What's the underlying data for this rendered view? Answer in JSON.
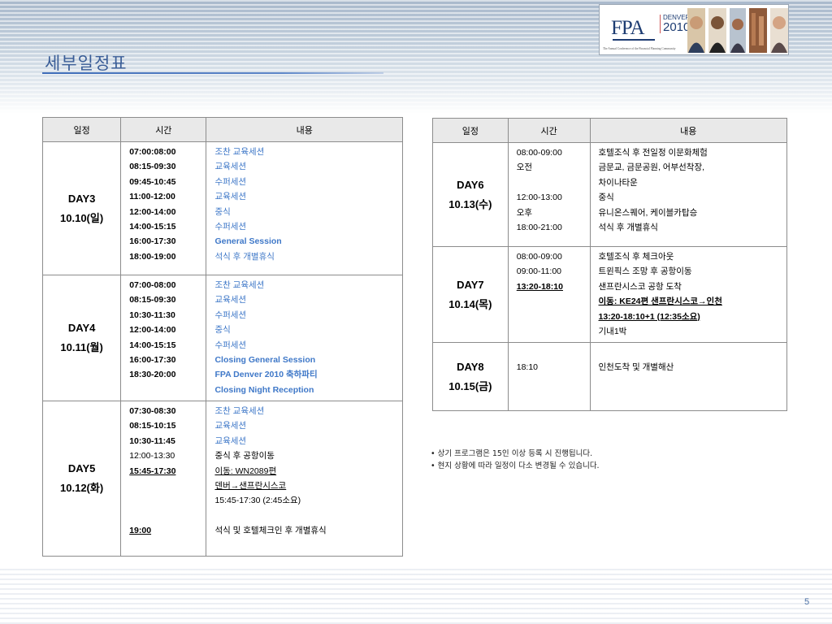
{
  "page": {
    "title": "세부일정표",
    "page_number": "5"
  },
  "logo": {
    "brand": "FPA",
    "event_top": "DENVER",
    "event_year": "2010",
    "tagline": "The Annual Conference of the Financial Planning Community"
  },
  "left_table": {
    "headers": [
      "일정",
      "시간",
      "내용"
    ],
    "days": [
      {
        "day": "DAY3",
        "date": "10.10(일)",
        "times": [
          "07:00:08:00",
          "08:15-09:30",
          "09:45-10:45",
          "11:00-12:00",
          "12:00-14:00",
          "14:00-15:15",
          "16:00-17:30",
          "18:00-19:00"
        ],
        "items": [
          "조찬 교육세션",
          "교육세션",
          "수퍼세션",
          "교육세션",
          "중식",
          "수퍼세션",
          "General Session",
          "석식 후 개별휴식"
        ]
      },
      {
        "day": "DAY4",
        "date": "10.11(월)",
        "times": [
          "07:00-08:00",
          "08:15-09:30",
          "10:30-11:30",
          "12:00-14:00",
          "14:00-15:15",
          "16:00-17:30",
          "18:30-20:00",
          ""
        ],
        "items": [
          "조찬 교육세션",
          "교육세션",
          "수퍼세션",
          "중식",
          "수퍼세션",
          "Closing General Session",
          "FPA Denver 2010 축하파티",
          "Closing Night Reception"
        ]
      },
      {
        "day": "DAY5",
        "date": "10.12(화)",
        "times": [
          "07:30-08:30",
          "08:15-10:15",
          "10:30-11:45",
          "12:00-13:30",
          "15:45-17:30",
          "",
          "",
          "",
          "19:00"
        ],
        "items": [
          "조찬 교육세션",
          "교육세션",
          "교육세션",
          "중식 후 공항이동",
          "이동: WN2089편",
          "덴버→샌프란시스코",
          "15:45-17:30 (2:45소요)",
          "",
          "석식 및 호텔체크인 후 개별휴식"
        ]
      }
    ]
  },
  "right_table": {
    "headers": [
      "일정",
      "시간",
      "내용"
    ],
    "days": [
      {
        "day": "DAY6",
        "date": "10.13(수)",
        "times": [
          "08:00-09:00",
          "오전",
          "",
          "12:00-13:00",
          "오후",
          "18:00-21:00"
        ],
        "items": [
          "호텔조식 후 전일정 이문화체험",
          "금문교, 금문공원, 어부선착장,",
          "차이나타운",
          "중식",
          "유니온스퀘어, 케이블카탑승",
          "석식 후 개별휴식"
        ]
      },
      {
        "day": "DAY7",
        "date": "10.14(목)",
        "times": [
          "08:00-09:00",
          "09:00-11:00",
          "13:20-18:10",
          "",
          "",
          ""
        ],
        "items": [
          "호텔조식 후 체크아웃",
          "트윈픽스 조망 후 공항이동",
          "샌프란시스코 공항 도착",
          "이동: KE24편 샌프란시스코→인천",
          "13:20-18:10+1 (12:35소요)",
          "기내1박"
        ]
      },
      {
        "day": "DAY8",
        "date": "10.15(금)",
        "times": [
          "18:10"
        ],
        "items": [
          "인천도착 및 개별해산"
        ]
      }
    ]
  },
  "notes": [
    "• 상기 프로그램은 15인 이상 등록 시 진행됩니다.",
    "• 현지 상황에 따라 일정이 다소 변경될 수 있습니다."
  ]
}
